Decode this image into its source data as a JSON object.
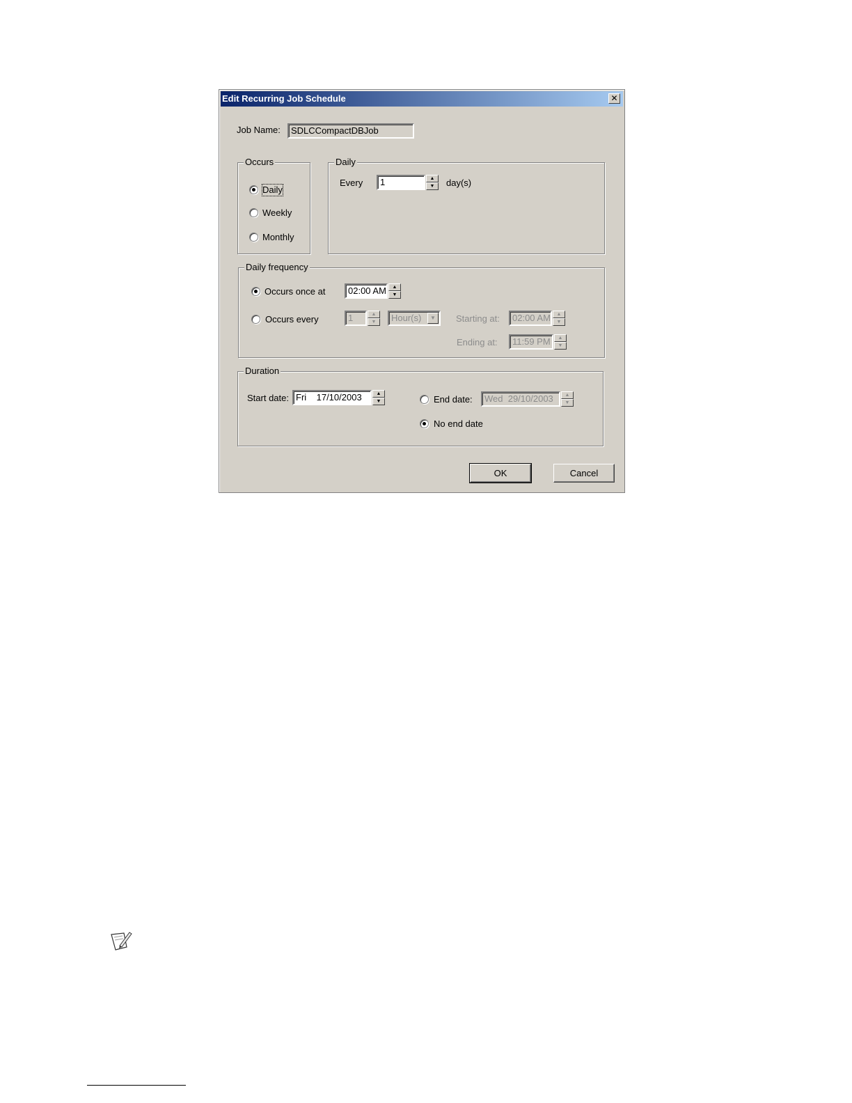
{
  "dialog": {
    "title": "Edit Recurring  Job Schedule",
    "close_glyph": "✕",
    "job_name_label": "Job Name:",
    "job_name_value": "SDLCCompactDBJob",
    "occurs": {
      "title": "Occurs",
      "options": [
        "Daily",
        "Weekly",
        "Monthly"
      ],
      "selected": "Daily"
    },
    "daily": {
      "title": "Daily",
      "every_label": "Every",
      "every_value": "1",
      "unit_label": "day(s)"
    },
    "daily_frequency": {
      "title": "Daily frequency",
      "once_label": "Occurs once at",
      "once_time": "02:00 AM",
      "every_label": "Occurs every",
      "every_value": "1",
      "every_unit": "Hour(s)",
      "starting_label": "Starting at:",
      "starting_time": "02:00 AM",
      "ending_label": "Ending at:",
      "ending_time": "11:59 PM",
      "selected": "once"
    },
    "duration": {
      "title": "Duration",
      "start_label": "Start date:",
      "start_value": "Fri    17/10/2003",
      "end_label": "End date:",
      "end_value": "Wed  29/10/2003",
      "no_end_label": "No end date",
      "selected": "no_end"
    },
    "buttons": {
      "ok": "OK",
      "cancel": "Cancel"
    }
  },
  "icons": {
    "note": "note-pencil-icon"
  }
}
